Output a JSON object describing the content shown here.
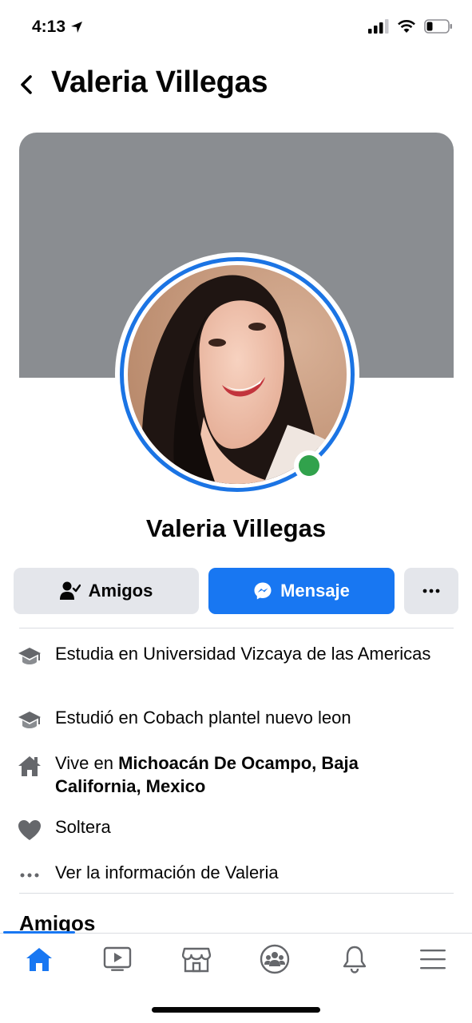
{
  "status_bar": {
    "time": "4:13"
  },
  "header": {
    "title": "Valeria Villegas"
  },
  "profile": {
    "name": "Valeria Villegas",
    "online": true
  },
  "actions": {
    "friends_label": "Amigos",
    "message_label": "Mensaje",
    "more_label": "···"
  },
  "info": {
    "study_current": "Estudia en Universidad Vizcaya de las Americas",
    "study_past": "Estudió en Cobach plantel nuevo leon",
    "lives_prefix": "Vive en ",
    "lives_place": "Michoacán De Ocampo, Baja California, Mexico",
    "relationship": "Soltera",
    "see_more": "Ver la información de Valeria"
  },
  "sections": {
    "friends_heading": "Amigos"
  },
  "nav": {
    "tabs": [
      "home-icon",
      "video-icon",
      "marketplace-icon",
      "groups-icon",
      "notifications-icon",
      "menu-icon"
    ],
    "active_tab": "home-icon"
  },
  "colors": {
    "accent": "#1877f2",
    "online": "#31a24c",
    "cover": "#8a8d91",
    "button_gray": "#e4e6eb"
  }
}
